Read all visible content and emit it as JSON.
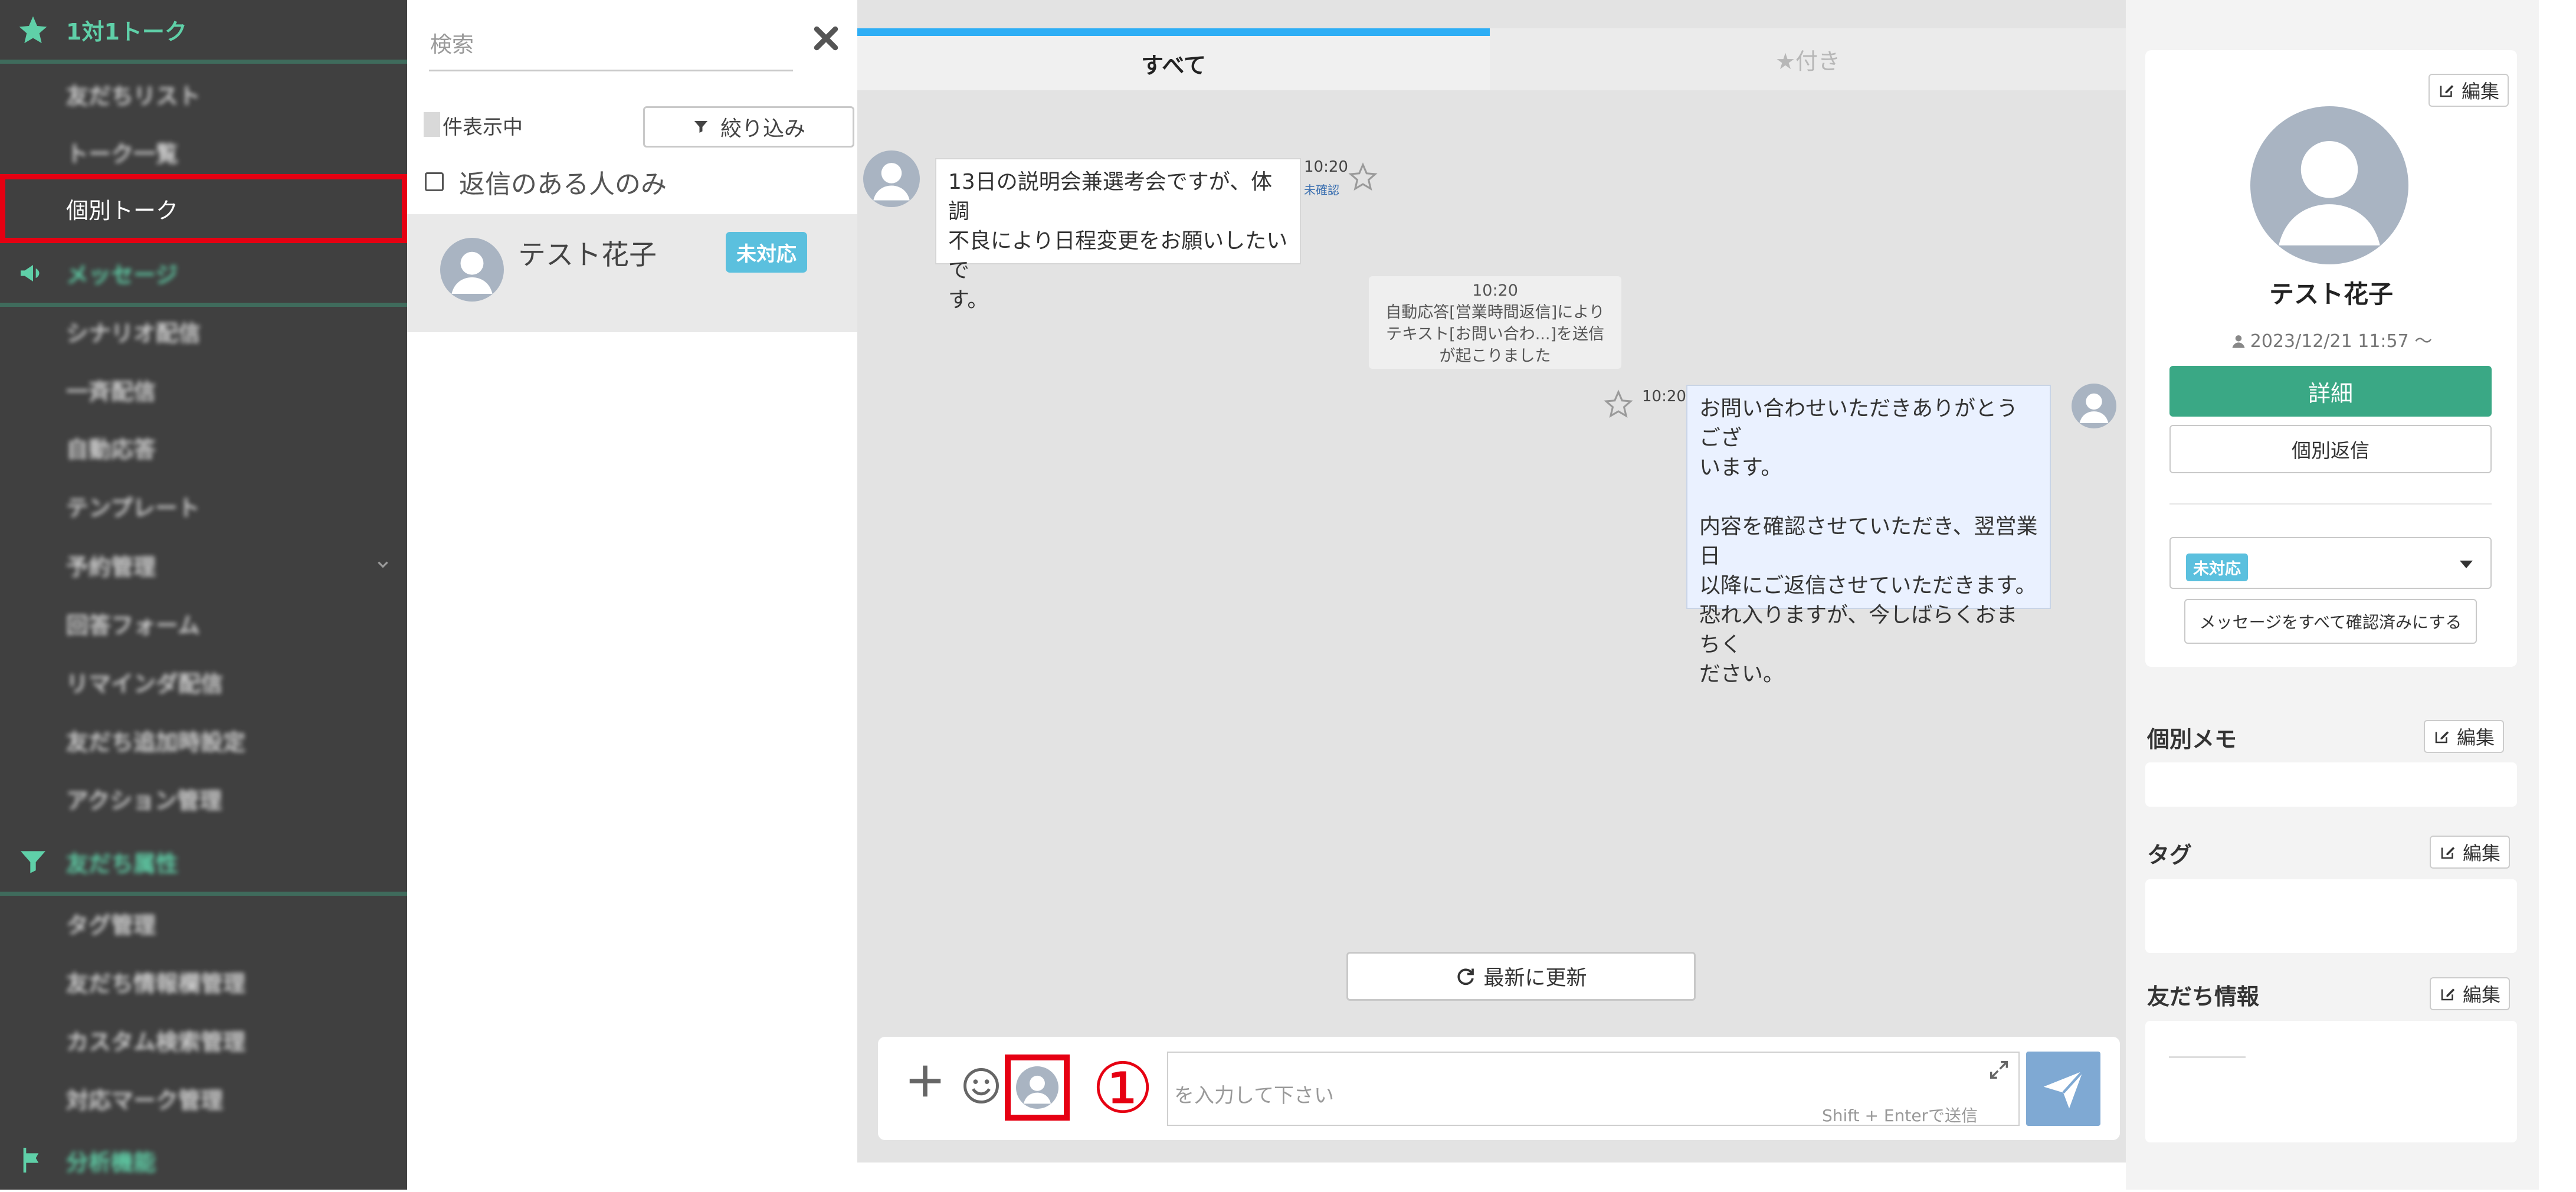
{
  "sidebar": {
    "group1_label": "1対1トーク",
    "items": [
      {
        "label": "友だちリスト"
      },
      {
        "label": "トーク一覧"
      },
      {
        "label": "個別トーク"
      },
      {
        "label": "シナリオ配信"
      },
      {
        "label": "一斉配信"
      },
      {
        "label": "自動応答"
      },
      {
        "label": "テンプレート"
      },
      {
        "label": "予約管理"
      },
      {
        "label": "回答フォーム"
      },
      {
        "label": "リマインダ配信"
      },
      {
        "label": "友だち追加時設定"
      },
      {
        "label": "アクション管理"
      },
      {
        "label": "タグ管理"
      },
      {
        "label": "友だち情報欄管理"
      },
      {
        "label": "カスタム検索管理"
      },
      {
        "label": "対応マーク管理"
      }
    ],
    "group2_label": "メッセージ",
    "group3_label": "友だち属性",
    "group4_label": "分析機能",
    "accent": "#5fd0a8",
    "highlight": "#e60012"
  },
  "list": {
    "search_placeholder": "検索",
    "count_label": "件表示中",
    "filter_label": "絞り込み",
    "reply_only_label": "返信のある人のみ",
    "friend": {
      "name": "テスト花子",
      "status": "未対応"
    }
  },
  "chat": {
    "tab_all": "すべて",
    "tab_starred": "★付き",
    "messages": [
      {
        "text": "13日の説明会兼選考会ですが、体調\n不良により日程変更をお願いしたいで\nす。",
        "time": "10:20",
        "status": "未確認"
      },
      {
        "text": "お問い合わせいただきありがとうござ\nいます。\n\n内容を確認させていただき、翌営業日\n以降にご返信させていただきます。\n恐れ入りますが、今しばらくおまちく\nださい。",
        "time": "10:20"
      }
    ],
    "system_note": {
      "time": "10:20",
      "text": "自動応答[営業時間返信]により\nテキスト[お問い合わ...]を送信\nが起こりました"
    },
    "refresh_label": "最新に更新",
    "composer": {
      "placeholder": "を入力して下さい",
      "hint": "Shift + Enterで送信",
      "step_marker": "①"
    }
  },
  "profile": {
    "edit_label": "編集",
    "name": "テスト花子",
    "since": "2023/12/21 11:57 〜",
    "detail_label": "詳細",
    "reply_label": "個別返信",
    "status": "未対応",
    "mark_read_label": "メッセージをすべて確認済みにする",
    "sections": {
      "memo": "個別メモ",
      "tag": "タグ",
      "friend_info": "友だち情報"
    }
  }
}
